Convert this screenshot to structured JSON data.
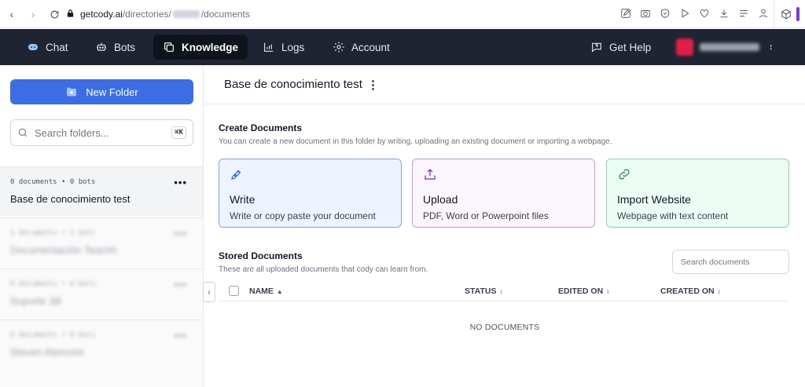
{
  "browser": {
    "url_host": "getcody.ai",
    "url_path_prefix": "/directories/",
    "url_path_suffix": "/documents"
  },
  "nav": {
    "chat": "Chat",
    "bots": "Bots",
    "knowledge": "Knowledge",
    "logs": "Logs",
    "account": "Account",
    "help": "Get Help"
  },
  "sidebar": {
    "new_folder_label": "New Folder",
    "search_placeholder": "Search folders...",
    "shortcut": "⌘K",
    "folders": [
      {
        "meta": "0 documents • 0 bots",
        "name": "Base de conocimiento test",
        "more": "•••"
      },
      {
        "meta": "1 documents • 1 bots",
        "name": "Documentación Teachh",
        "more": "•••"
      },
      {
        "meta": "0 documents • 0 bots",
        "name": "Soporte 3B",
        "more": "•••"
      },
      {
        "meta": "0 documents • 0 bots",
        "name": "Steven Atención",
        "more": "•••"
      }
    ]
  },
  "main": {
    "folder_title": "Base de conocimiento test",
    "kebab": "⋮",
    "create": {
      "title": "Create Documents",
      "subtitle": "You can create a new document in this folder by writing, uploading an existing document or importing a webpage.",
      "cards": [
        {
          "title": "Write",
          "desc": "Write or copy paste your document",
          "icon": "pen-nib-icon"
        },
        {
          "title": "Upload",
          "desc": "PDF, Word or Powerpoint files",
          "icon": "upload-icon"
        },
        {
          "title": "Import Website",
          "desc": "Webpage with text content",
          "icon": "link-icon"
        }
      ]
    },
    "stored": {
      "title": "Stored Documents",
      "subtitle": "These are all uploaded documents that cody can learn from.",
      "search_placeholder": "Search documents",
      "columns": [
        "NAME",
        "STATUS",
        "EDITED ON",
        "CREATED ON"
      ],
      "empty": "NO DOCUMENTS"
    }
  },
  "colors": {
    "nav_bg": "#1e2432",
    "primary": "#3b6ee6",
    "write_border": "#7fa6ea",
    "upload_border": "#c99ae8",
    "import_border": "#86d8a8"
  }
}
